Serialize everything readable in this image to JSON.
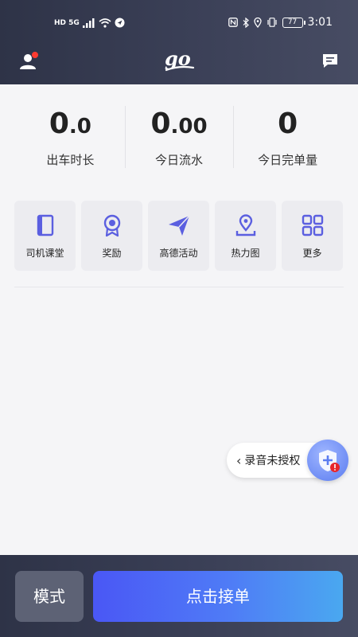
{
  "status_bar": {
    "network": "HD 5G",
    "battery": "77",
    "time": "3:01"
  },
  "header": {
    "logo_text": "go"
  },
  "stats": [
    {
      "value_int": "0",
      "value_dec": ".0",
      "label": "出车时长"
    },
    {
      "value_int": "0",
      "value_dec": ".00",
      "label": "今日流水"
    },
    {
      "value_int": "0",
      "value_dec": "",
      "label": "今日完单量"
    }
  ],
  "quick_actions": [
    {
      "label": "司机课堂",
      "icon": "book-icon"
    },
    {
      "label": "奖励",
      "icon": "medal-icon"
    },
    {
      "label": "高德活动",
      "icon": "paper-plane-icon"
    },
    {
      "label": "热力图",
      "icon": "map-pin-icon"
    },
    {
      "label": "更多",
      "icon": "grid-icon"
    }
  ],
  "recording_prompt": {
    "label": "录音未授权"
  },
  "bottom_bar": {
    "mode_label": "模式",
    "accept_label": "点击接单"
  },
  "colors": {
    "header_bg": "#2e3347",
    "accent_blue": "#4a57f5",
    "icon_purple": "#5b5fe0",
    "notification_red": "#ff3b30"
  }
}
